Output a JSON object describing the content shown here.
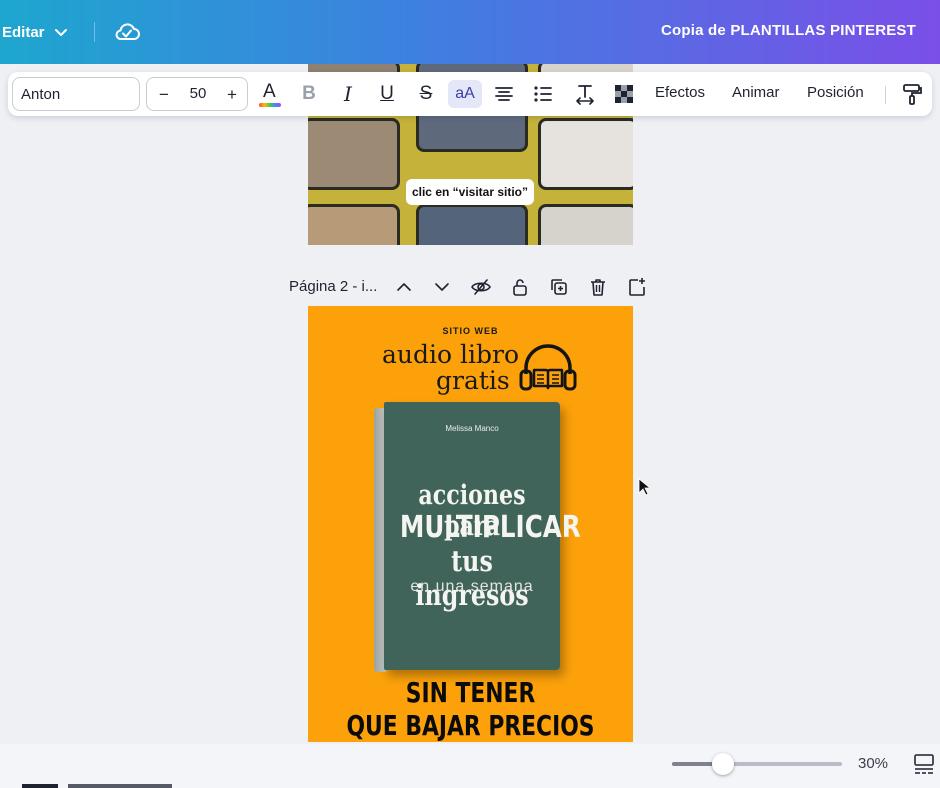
{
  "topbar": {
    "edit_label": "Editar",
    "doc_title": "Copia de PLANTILLAS PINTEREST"
  },
  "toolbar": {
    "font_name": "Anton",
    "size_minus": "−",
    "size_value": "50",
    "size_plus": "+",
    "color_letter": "A",
    "bold": "B",
    "italic": "I",
    "underline": "U",
    "strike": "S",
    "case": "aA",
    "effects": "Efectos",
    "animate": "Animar",
    "position": "Posición"
  },
  "page1": {
    "cta": "clic en “visitar sitio”"
  },
  "page_controls": {
    "label": "Página 2 - i..."
  },
  "page2": {
    "kicker": "SITIO WEB",
    "headline_1": "audio libro",
    "headline_2": "gratis",
    "book": {
      "author": "Melissa Manco",
      "title_1": "acciones para",
      "title_2": "MULTIPLICAR",
      "title_3": "tus ingresos",
      "title_4": "en una semana"
    },
    "footer_1": "SIN TENER",
    "footer_2": "QUE BAJAR PRECIOS"
  },
  "zoom": {
    "value_text": "30%",
    "level": 0.3
  }
}
